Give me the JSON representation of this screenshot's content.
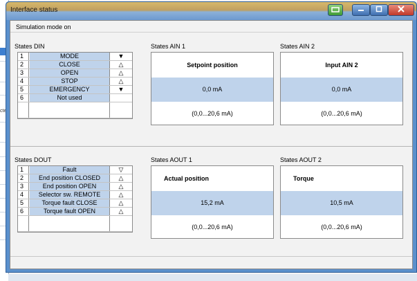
{
  "window": {
    "title": "Interface status"
  },
  "sim_mode": "Simulation mode on",
  "states_din": {
    "title": "States DIN",
    "rows": [
      {
        "num": "1",
        "label": "MODE",
        "indicator": "▼"
      },
      {
        "num": "2",
        "label": "CLOSE",
        "indicator": "△"
      },
      {
        "num": "3",
        "label": "OPEN",
        "indicator": "△"
      },
      {
        "num": "4",
        "label": "STOP",
        "indicator": "△"
      },
      {
        "num": "5",
        "label": "EMERGENCY",
        "indicator": "▼"
      },
      {
        "num": "6",
        "label": "Not used",
        "indicator": ""
      }
    ]
  },
  "states_dout": {
    "title": "States DOUT",
    "rows": [
      {
        "num": "1",
        "label": "Fault",
        "indicator": "▽"
      },
      {
        "num": "2",
        "label": "End position CLOSED",
        "indicator": "△"
      },
      {
        "num": "3",
        "label": "End position OPEN",
        "indicator": "△"
      },
      {
        "num": "4",
        "label": "Selector sw. REMOTE",
        "indicator": "△"
      },
      {
        "num": "5",
        "label": "Torque fault CLOSE",
        "indicator": "△"
      },
      {
        "num": "6",
        "label": "Torque fault OPEN",
        "indicator": "△"
      }
    ]
  },
  "ain1": {
    "title": "States AIN 1",
    "name": "Setpoint position",
    "value": "0,0 mA",
    "range": "(0,0...20,6 mA)"
  },
  "ain2": {
    "title": "States AIN 2",
    "name": "Input AIN 2",
    "value": "0,0 mA",
    "range": "(0,0...20,6 mA)"
  },
  "aout1": {
    "title": "States AOUT 1",
    "name": "Actual position",
    "value": "15,2 mA",
    "range": "(0,0...20,6 mA)"
  },
  "aout2": {
    "title": "States AOUT 2",
    "name": "Torque",
    "value": "10,5 mA",
    "range": "(0,0...20,6 mA)"
  },
  "background": {
    "cut_text": "cte"
  }
}
